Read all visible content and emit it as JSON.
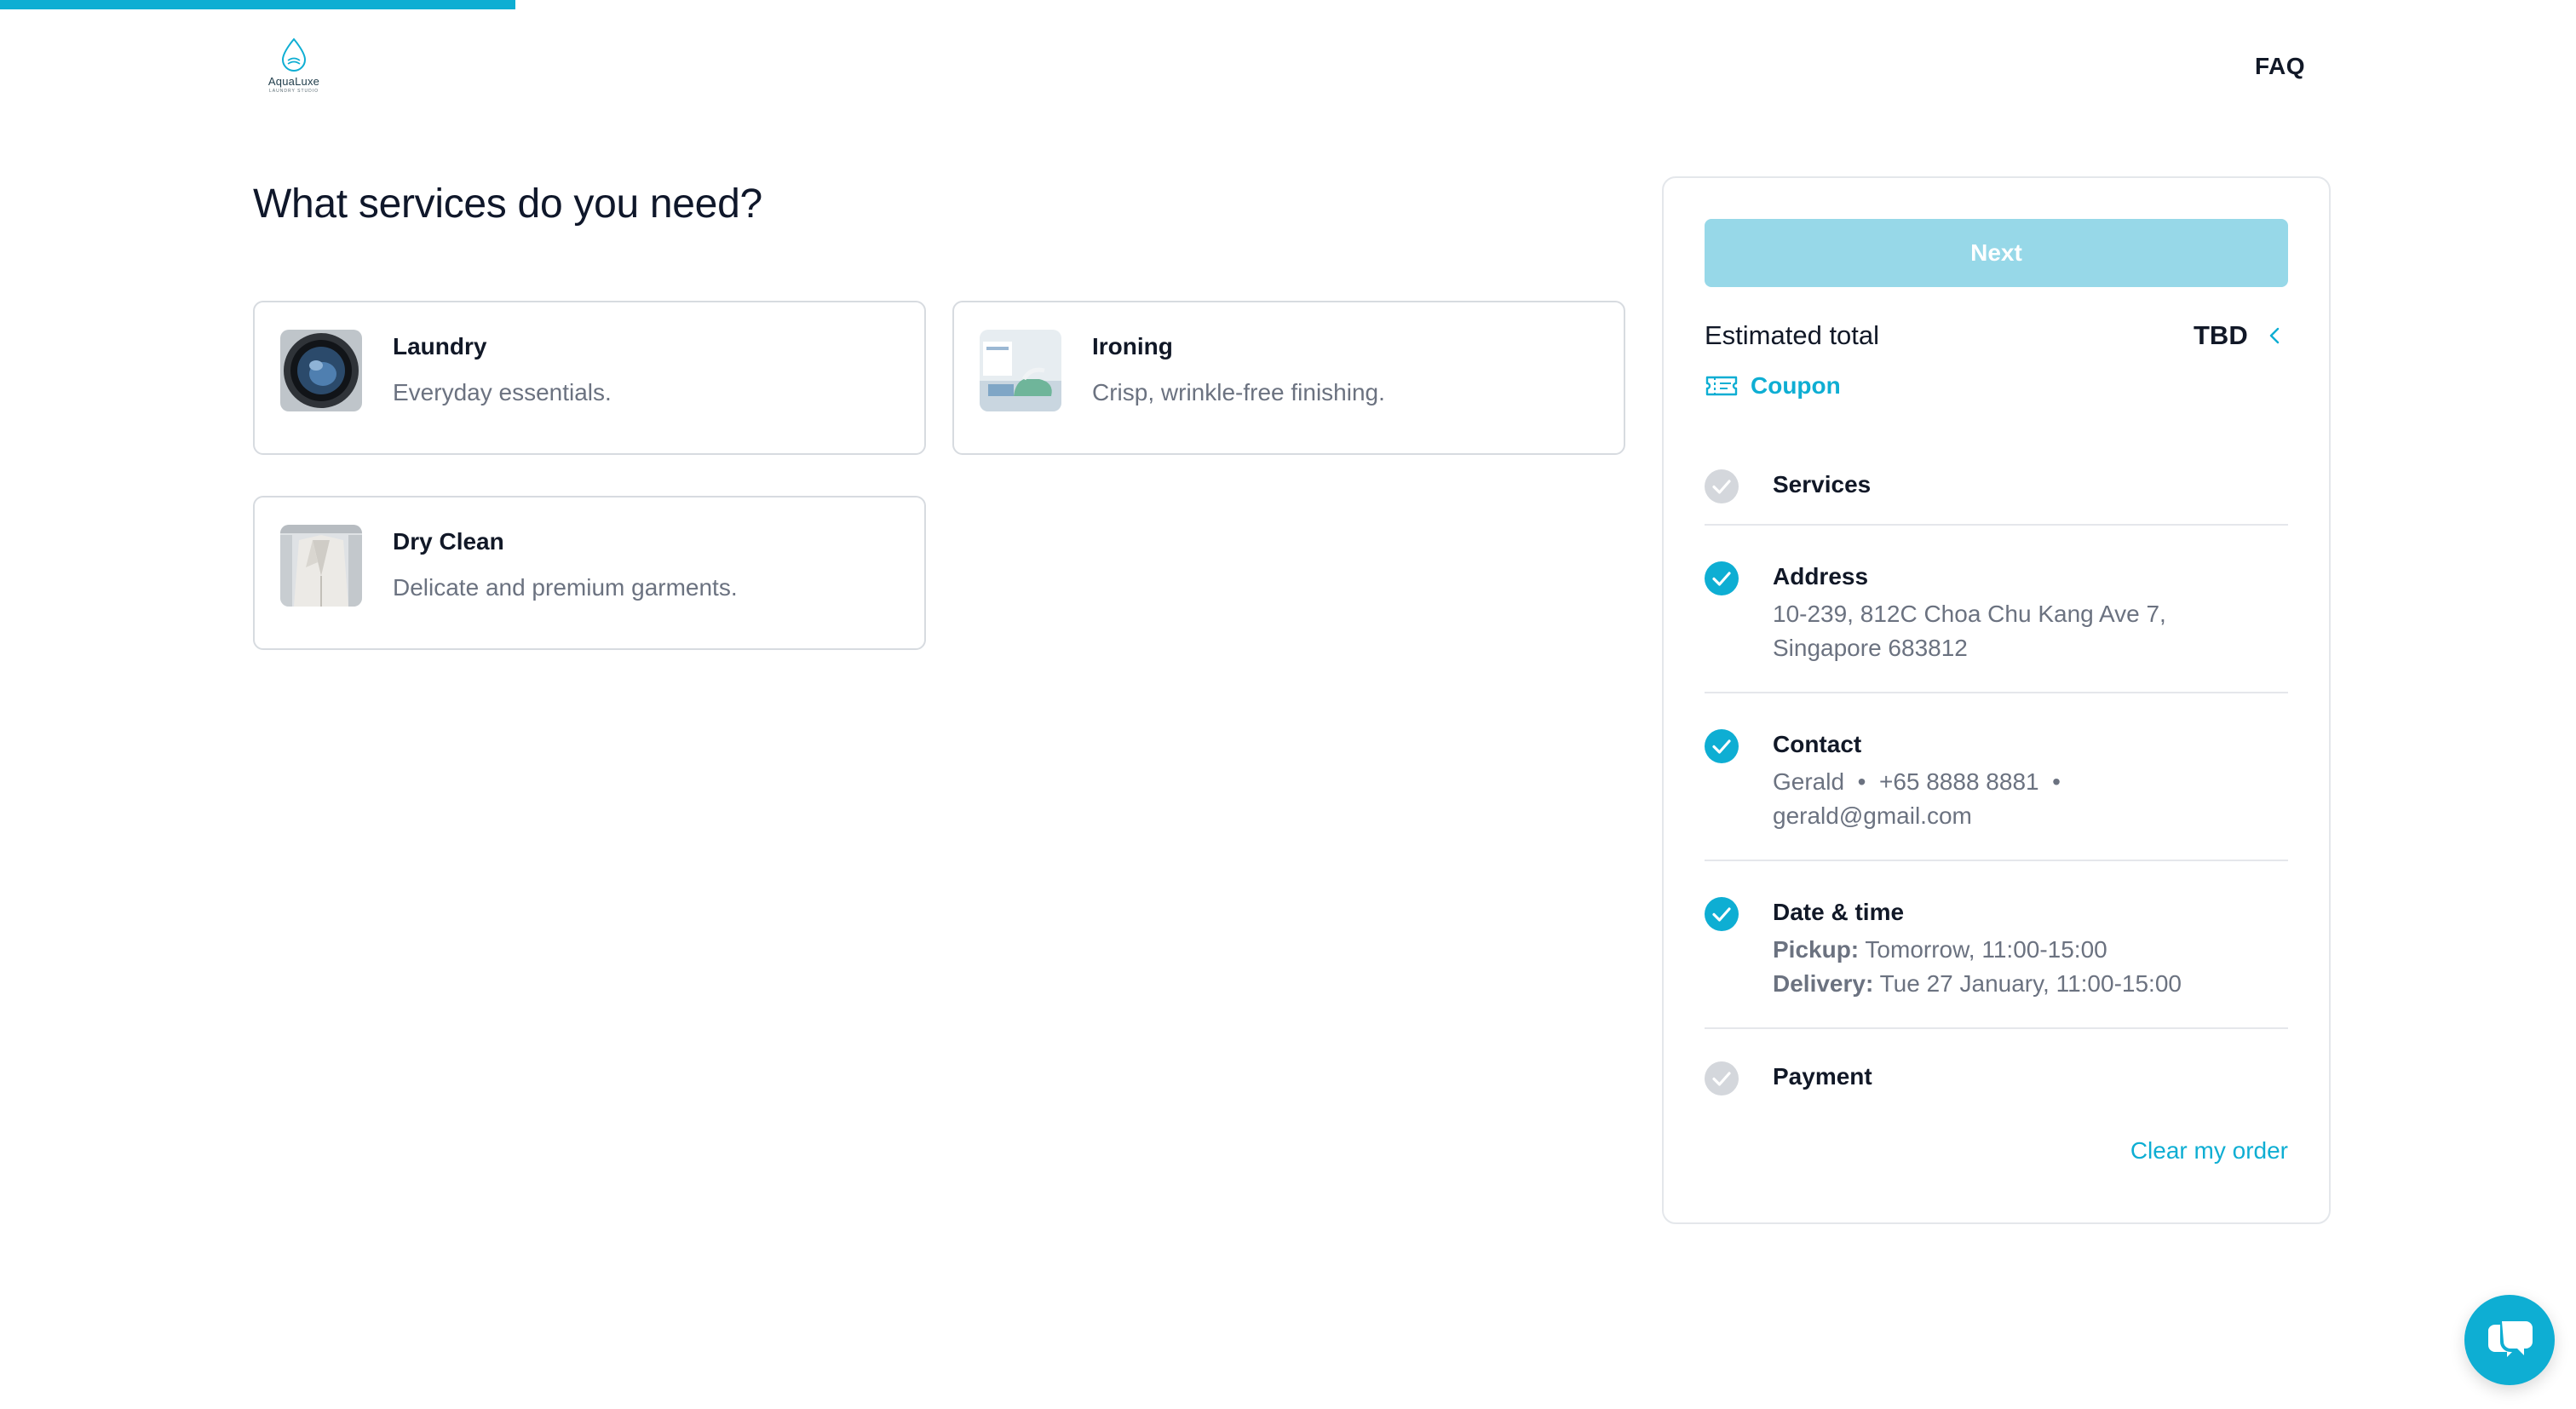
{
  "brand": {
    "name": "AquaLuxe",
    "tagline": "LAUNDRY STUDIO"
  },
  "colors": {
    "accent": "#0eaed3",
    "accent_light": "#97d8e8",
    "check_done": "#0eaed3",
    "check_pending": "#d4d7dc"
  },
  "progress": {
    "fraction": 0.2
  },
  "header": {
    "faq_label": "FAQ"
  },
  "main": {
    "title": "What services do you need?",
    "services": [
      {
        "name": "Laundry",
        "description": "Everyday essentials.",
        "icon": "washing-machine-photo"
      },
      {
        "name": "Ironing",
        "description": "Crisp, wrinkle-free finishing.",
        "icon": "iron-photo"
      },
      {
        "name": "Dry Clean",
        "description": "Delicate and premium garments.",
        "icon": "suit-photo"
      }
    ]
  },
  "summary": {
    "next_label": "Next",
    "estimated_label": "Estimated total",
    "estimated_value": "TBD",
    "coupon_label": "Coupon",
    "steps": [
      {
        "title": "Services",
        "done": false,
        "lines": []
      },
      {
        "title": "Address",
        "done": true,
        "lines": [
          "10-239, 812C Choa Chu Kang Ave 7,",
          "Singapore 683812"
        ]
      },
      {
        "title": "Contact",
        "done": true,
        "lines": [
          "Gerald  •  +65 8888 8881  •",
          "gerald@gmail.com"
        ]
      },
      {
        "title": "Date & time",
        "done": true,
        "pickup_label": "Pickup:",
        "pickup_value": "Tomorrow, 11:00-15:00",
        "delivery_label": "Delivery:",
        "delivery_value": "Tue 27 January, 11:00-15:00"
      },
      {
        "title": "Payment",
        "done": false,
        "lines": []
      }
    ],
    "clear_label": "Clear my order"
  }
}
